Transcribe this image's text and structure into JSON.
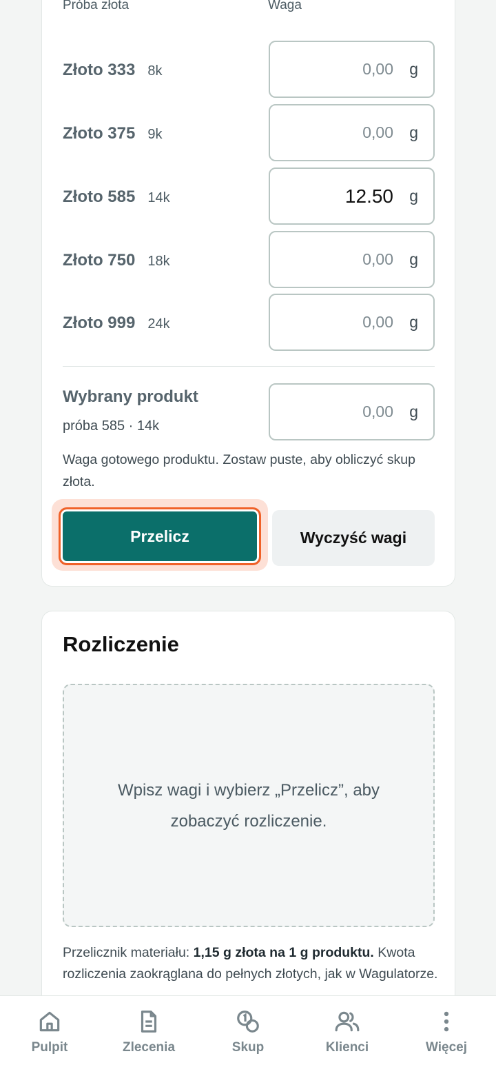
{
  "weights": {
    "col_purity": "Próba złota",
    "col_weight": "Waga",
    "rows": [
      {
        "name": "Złoto 333",
        "karat": "8k",
        "value": "",
        "placeholder": "0,00",
        "unit": "g"
      },
      {
        "name": "Złoto 375",
        "karat": "9k",
        "value": "",
        "placeholder": "0,00",
        "unit": "g"
      },
      {
        "name": "Złoto 585",
        "karat": "14k",
        "value": "12.50",
        "placeholder": "0,00",
        "unit": "g"
      },
      {
        "name": "Złoto 750",
        "karat": "18k",
        "value": "",
        "placeholder": "0,00",
        "unit": "g"
      },
      {
        "name": "Złoto 999",
        "karat": "24k",
        "value": "",
        "placeholder": "0,00",
        "unit": "g"
      }
    ],
    "product": {
      "title": "Wybrany produkt",
      "subtitle": "próba 585 · 14k",
      "placeholder": "0,00",
      "unit": "g"
    },
    "hint": "Waga gotowego produktu. Zostaw puste, aby obliczyć skup złota.",
    "calc_label": "Przelicz",
    "clear_label": "Wyczyść wagi"
  },
  "settlement": {
    "title": "Rozliczenie",
    "empty_text": "Wpisz wagi i wybierz „Przelicz”, aby zobaczyć rozliczenie.",
    "note_prefix": "Przelicznik materiału: ",
    "note_bold": "1,15 g złota na 1 g produktu.",
    "note_suffix": " Kwota rozliczenia zaokrąglana do pełnych złotych, jak w Wagulatorze."
  },
  "nav": [
    {
      "label": "Pulpit",
      "icon": "home-icon"
    },
    {
      "label": "Zlecenia",
      "icon": "document-icon"
    },
    {
      "label": "Skup",
      "icon": "coins-icon"
    },
    {
      "label": "Klienci",
      "icon": "users-icon"
    },
    {
      "label": "Więcej",
      "icon": "more-vertical-icon"
    }
  ],
  "colors": {
    "primary": "#0b6f6a",
    "focus_ring": "#f06128",
    "nav_text": "#7a878d"
  }
}
